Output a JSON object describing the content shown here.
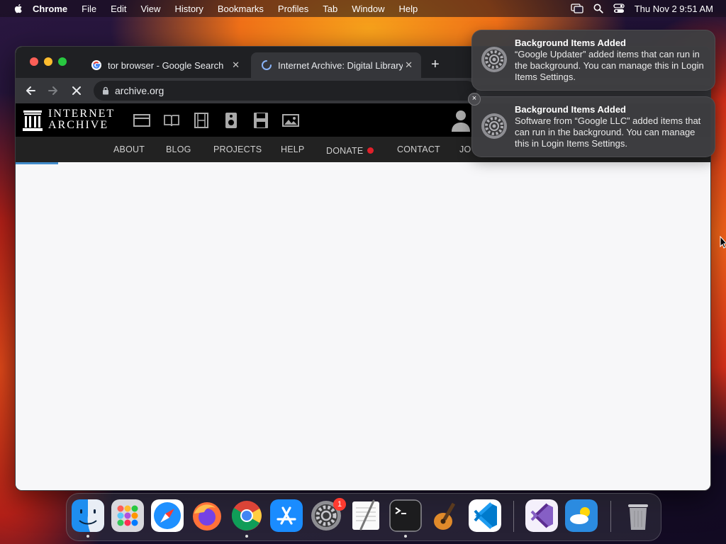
{
  "menubar": {
    "app_name": "Chrome",
    "items": [
      "File",
      "Edit",
      "View",
      "History",
      "Bookmarks",
      "Profiles",
      "Tab",
      "Window",
      "Help"
    ],
    "clock": "Thu Nov 2  9:51 AM"
  },
  "browser": {
    "tabs": [
      {
        "title": "tor browser - Google Search",
        "close": "✕"
      },
      {
        "title": "Internet Archive: Digital Library",
        "close": "✕"
      }
    ],
    "new_tab": "+",
    "url": "archive.org"
  },
  "archive": {
    "logo_line1": "INTERNET",
    "logo_line2": "ARCHIVE",
    "nav": [
      "ABOUT",
      "BLOG",
      "PROJECTS",
      "HELP",
      "DONATE",
      "CONTACT",
      "JO"
    ],
    "donate_heart_color": "#e0202a"
  },
  "notifications": [
    {
      "title": "Background Items Added",
      "body": "“Google Updater” added items that can run in the background. You can manage this in Login Items Settings."
    },
    {
      "title": "Background Items Added",
      "body": "Software from “Google LLC” added items that can run in the background. You can manage this in Login Items Settings."
    }
  ],
  "notification_close": "×",
  "dock": {
    "apps": [
      "finder-icon",
      "launchpad-icon",
      "safari-icon",
      "firefox-icon",
      "chrome-icon",
      "app-store-icon",
      "system-settings-icon",
      "textedit-icon",
      "terminal-icon",
      "garageband-icon",
      "vscode-icon",
      "visual-studio-icon",
      "weather-icon",
      "trash-icon"
    ],
    "settings_badge": "1"
  }
}
